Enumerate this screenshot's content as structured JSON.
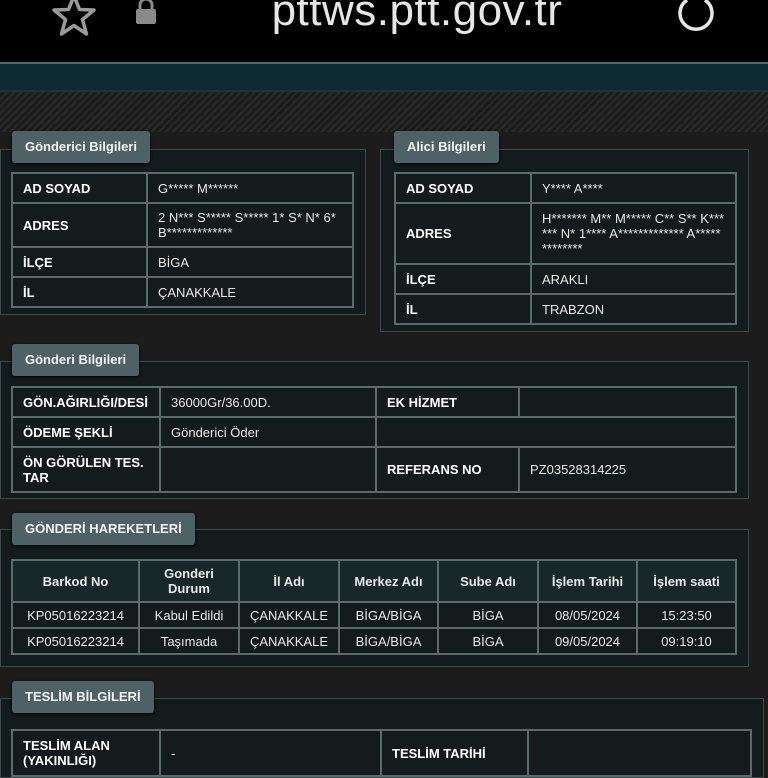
{
  "browser": {
    "url": "pttws.ptt.gov.tr"
  },
  "sender": {
    "title": "Gönderici Bilgileri",
    "rows": [
      {
        "label": "AD SOYAD",
        "value": "G***** M******"
      },
      {
        "label": "ADRES",
        "value": "2 N*** S***** S***** 1* S* N* 6* B*************"
      },
      {
        "label": "İLÇE",
        "value": "BİGA"
      },
      {
        "label": "İL",
        "value": "ÇANAKKALE"
      }
    ]
  },
  "receiver": {
    "title": "Alici Bilgileri",
    "rows": [
      {
        "label": "AD SOYAD",
        "value": "Y**** A****"
      },
      {
        "label": "ADRES",
        "value": "H******* M** M***** C** S** K****** N* 1**** A************* A*************"
      },
      {
        "label": "İLÇE",
        "value": "ARAKLI"
      },
      {
        "label": "İL",
        "value": "TRABZON"
      }
    ]
  },
  "shipment": {
    "title": "Gönderi Bilgileri",
    "weight_label": "GÖN.AĞIRLIĞI/DESİ",
    "weight_value": "36000Gr/36.00D.",
    "extra_label": "EK HİZMET",
    "extra_value": "",
    "payment_label": "ÖDEME ŞEKLİ",
    "payment_value": "Gönderici Öder",
    "expected_label": "ÖN GÖRÜLEN TES. TAR",
    "expected_value": "",
    "ref_label": "REFERANS NO",
    "ref_value": "PZ03528314225"
  },
  "movements": {
    "title": "GÖNDERİ HAREKETLERİ",
    "headers": [
      "Barkod No",
      "Gonderi Durum",
      "İl Adı",
      "Merkez Adı",
      "Sube Adı",
      "İşlem Tarihi",
      "İşlem saati"
    ],
    "rows": [
      [
        "KP05016223214",
        "Kabul Edildi",
        "ÇANAKKALE",
        "BİGA/BİGA",
        "BİGA",
        "08/05/2024",
        "15:23:50"
      ],
      [
        "KP05016223214",
        "Taşımada",
        "ÇANAKKALE",
        "BİGA/BİGA",
        "BİGA",
        "09/05/2024",
        "09:19:10"
      ]
    ]
  },
  "delivery": {
    "title": "TESLİM BİLGİLERİ",
    "receiver_label": "TESLİM ALAN (YAKINLIĞI)",
    "receiver_value": "-",
    "date_label": "TESLİM TARİHİ",
    "date_value": ""
  }
}
